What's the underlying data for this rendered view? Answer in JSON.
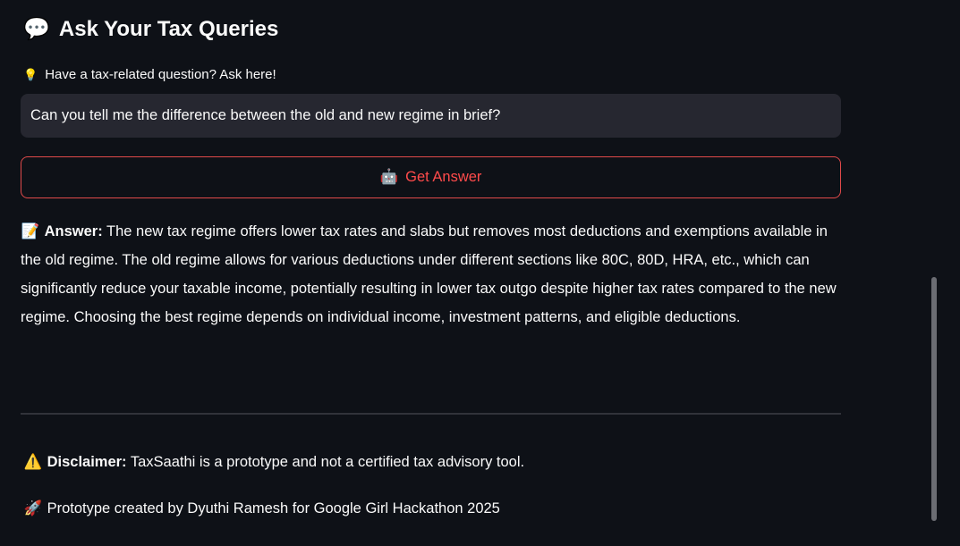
{
  "header": {
    "icon": "speech-bubble-icon",
    "title": "Ask Your Tax Queries"
  },
  "question": {
    "icon": "lightbulb-icon",
    "label": "Have a tax-related question? Ask here!",
    "value": "Can you tell me the difference between the old and new regime in brief?"
  },
  "button": {
    "icon": "robot-icon",
    "label": "Get Answer"
  },
  "answer": {
    "icon": "memo-icon",
    "label": "Answer:",
    "text": "The new tax regime offers lower tax rates and slabs but removes most deductions and exemptions available in the old regime. The old regime allows for various deductions under different sections like 80C, 80D, HRA, etc., which can significantly reduce your taxable income, potentially resulting in lower tax outgo despite higher tax rates compared to the new regime. Choosing the best regime depends on individual income, investment patterns, and eligible deductions."
  },
  "footer": {
    "disclaimer_icon": "warning-icon",
    "disclaimer_label": "Disclaimer:",
    "disclaimer_text": "TaxSaathi is a prototype and not a certified tax advisory tool.",
    "credit_icon": "rocket-icon",
    "credit_text": "Prototype created by Dyuthi Ramesh for Google Girl Hackathon 2025"
  },
  "colors": {
    "background": "#0e1117",
    "input_bg": "#262730",
    "accent": "#ff4b4b"
  }
}
